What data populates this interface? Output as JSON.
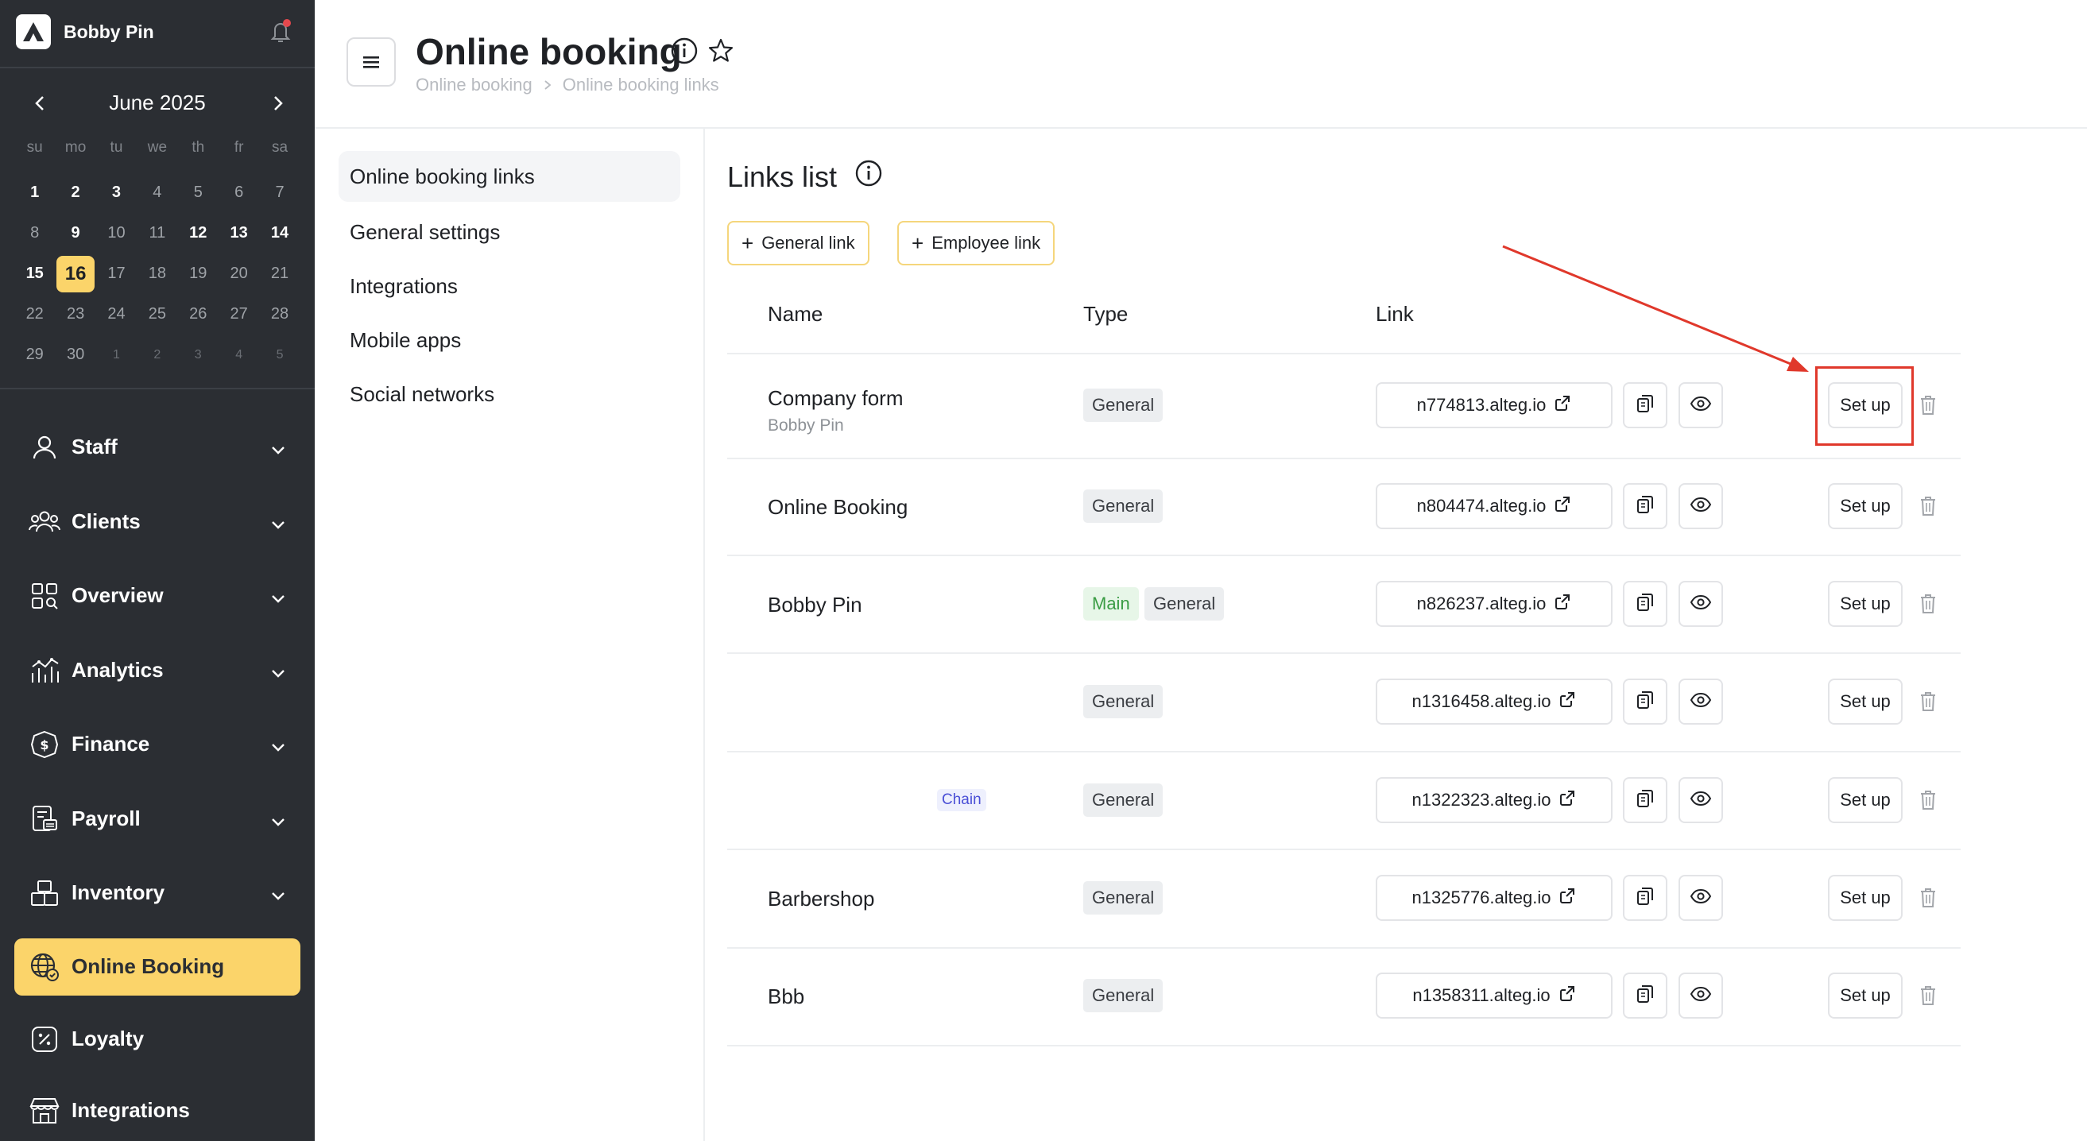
{
  "sidebar": {
    "brand_name": "Bobby Pin",
    "calendar": {
      "month_label": "June 2025",
      "weekdays": [
        "su",
        "mo",
        "tu",
        "we",
        "th",
        "fr",
        "sa"
      ],
      "days": [
        {
          "d": "1",
          "s": "b"
        },
        {
          "d": "2",
          "s": "b"
        },
        {
          "d": "3",
          "s": "b"
        },
        {
          "d": "4",
          "s": "n"
        },
        {
          "d": "5",
          "s": "n"
        },
        {
          "d": "6",
          "s": "n"
        },
        {
          "d": "7",
          "s": "n"
        },
        {
          "d": "8",
          "s": "n"
        },
        {
          "d": "9",
          "s": "b"
        },
        {
          "d": "10",
          "s": "n"
        },
        {
          "d": "11",
          "s": "n"
        },
        {
          "d": "12",
          "s": "b"
        },
        {
          "d": "13",
          "s": "b"
        },
        {
          "d": "14",
          "s": "b"
        },
        {
          "d": "15",
          "s": "b"
        },
        {
          "d": "16",
          "s": "today"
        },
        {
          "d": "17",
          "s": "n"
        },
        {
          "d": "18",
          "s": "n"
        },
        {
          "d": "19",
          "s": "n"
        },
        {
          "d": "20",
          "s": "n"
        },
        {
          "d": "21",
          "s": "n"
        },
        {
          "d": "22",
          "s": "n"
        },
        {
          "d": "23",
          "s": "n"
        },
        {
          "d": "24",
          "s": "n"
        },
        {
          "d": "25",
          "s": "n"
        },
        {
          "d": "26",
          "s": "n"
        },
        {
          "d": "27",
          "s": "n"
        },
        {
          "d": "28",
          "s": "n"
        },
        {
          "d": "29",
          "s": "n"
        },
        {
          "d": "30",
          "s": "n"
        },
        {
          "d": "1",
          "s": "o"
        },
        {
          "d": "2",
          "s": "o"
        },
        {
          "d": "3",
          "s": "o"
        },
        {
          "d": "4",
          "s": "o"
        },
        {
          "d": "5",
          "s": "o"
        }
      ]
    },
    "nav": [
      {
        "label": "Staff",
        "icon": "user-icon",
        "chevron": true
      },
      {
        "label": "Clients",
        "icon": "clients-icon",
        "chevron": true
      },
      {
        "label": "Overview",
        "icon": "overview-grid-icon",
        "chevron": true
      },
      {
        "label": "Analytics",
        "icon": "analytics-icon",
        "chevron": true
      },
      {
        "label": "Finance",
        "icon": "finance-icon",
        "chevron": true
      },
      {
        "label": "Payroll",
        "icon": "payroll-icon",
        "chevron": true
      },
      {
        "label": "Inventory",
        "icon": "inventory-icon",
        "chevron": true
      },
      {
        "label": "Online Booking",
        "icon": "globe-icon",
        "chevron": false,
        "active": true
      },
      {
        "label": "Loyalty",
        "icon": "loyalty-icon",
        "chevron": false
      },
      {
        "label": "Integrations",
        "icon": "store-icon",
        "chevron": false
      }
    ]
  },
  "header": {
    "title": "Online booking",
    "breadcrumb": [
      "Online booking",
      "Online booking links"
    ]
  },
  "subnav": [
    {
      "label": "Online booking links",
      "active": true
    },
    {
      "label": "General settings"
    },
    {
      "label": "Integrations"
    },
    {
      "label": "Mobile apps"
    },
    {
      "label": "Social networks"
    }
  ],
  "main": {
    "section_title": "Links list",
    "buttons": {
      "general_link": "General link",
      "employee_link": "Employee link"
    },
    "columns": {
      "name": "Name",
      "type": "Type",
      "link": "Link"
    },
    "setup_label": "Set up",
    "rows": [
      {
        "name": "Company form",
        "sub": "Bobby Pin",
        "chain": "",
        "badges": [
          "General"
        ],
        "link": "n774813.alteg.io"
      },
      {
        "name": "Online Booking",
        "sub": "",
        "chain": "",
        "badges": [
          "General"
        ],
        "link": "n804474.alteg.io"
      },
      {
        "name": "Bobby Pin",
        "sub": "",
        "chain": "",
        "badges": [
          "Main",
          "General"
        ],
        "link": "n826237.alteg.io"
      },
      {
        "name": "",
        "sub": "",
        "chain": "",
        "badges": [
          "General"
        ],
        "link": "n1316458.alteg.io"
      },
      {
        "name": "",
        "sub": "",
        "chain": "Chain",
        "badges": [
          "General"
        ],
        "link": "n1322323.alteg.io"
      },
      {
        "name": "Barbershop",
        "sub": "",
        "chain": "",
        "badges": [
          "General"
        ],
        "link": "n1325776.alteg.io"
      },
      {
        "name": "Bbb",
        "sub": "",
        "chain": "",
        "badges": [
          "General"
        ],
        "link": "n1358311.alteg.io"
      }
    ]
  },
  "colors": {
    "accent": "#fbd46a",
    "sidebar_bg": "#2b2e33",
    "annotation": "#e0382b",
    "main_badge_text": "#3a9c44",
    "chain_text": "#4a4fd6"
  }
}
